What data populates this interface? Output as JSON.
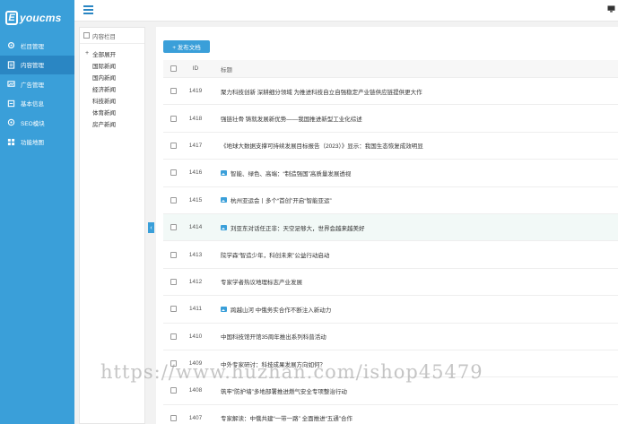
{
  "logo": {
    "letter": "E",
    "text": "youcms"
  },
  "sidebar": {
    "items": [
      {
        "label": "栏目管理",
        "icon": "gear-icon",
        "active": false
      },
      {
        "label": "内容管理",
        "icon": "document-icon",
        "active": true
      },
      {
        "label": "广告管理",
        "icon": "picture-icon",
        "active": false
      },
      {
        "label": "基本信息",
        "icon": "info-icon",
        "active": false
      },
      {
        "label": "SEO模块",
        "icon": "search-icon",
        "active": false
      },
      {
        "label": "功能地图",
        "icon": "map-icon",
        "active": false
      }
    ]
  },
  "tree": {
    "header": "内容栏目",
    "root": "全部展开",
    "items": [
      "国际新闻",
      "国内新闻",
      "经济新闻",
      "科技新闻",
      "体育新闻",
      "房产新闻"
    ]
  },
  "toolbar": {
    "publish_label": "+ 发布文档"
  },
  "table": {
    "columns": {
      "id": "ID",
      "title": "标题"
    },
    "rows": [
      {
        "id": "1419",
        "title": "聚力科技创新 深耕细分领域 为推进科技自立自强稳定产业链供应链提供更大作",
        "has_image": false
      },
      {
        "id": "1418",
        "title": "强链壮骨 铸就发展新优势——我国推进新型工业化综述",
        "has_image": false
      },
      {
        "id": "1417",
        "title": "《地球大数据支撑可持续发展目标报告（2023）》显示：我国生态恢复成效明显",
        "has_image": false
      },
      {
        "id": "1416",
        "title": "智能、绿色、高端：“制造强国”高质量发展透视",
        "has_image": true
      },
      {
        "id": "1415",
        "title": "杭州亚运会丨多个“首创”开启“智能亚运”",
        "has_image": true
      },
      {
        "id": "1414",
        "title": "刘亚东对话任正非：天空足够大，世界会越来越美好",
        "has_image": true
      },
      {
        "id": "1413",
        "title": "院学森“智造少年，科创未来”公益行动启动",
        "has_image": false
      },
      {
        "id": "1412",
        "title": "专家学者热议地理标志产业发展",
        "has_image": false
      },
      {
        "id": "1411",
        "title": "跨越山河 中俄务实合作不断注入新动力",
        "has_image": true
      },
      {
        "id": "1410",
        "title": "中国科技馆开馆35周年推出系列科普活动",
        "has_image": false
      },
      {
        "id": "1409",
        "title": "中外专家研讨：科技成果发展方向如何？",
        "has_image": false
      },
      {
        "id": "1408",
        "title": "筑牢“防护墙”多地部署推进燃气安全专项整治行动",
        "has_image": false
      },
      {
        "id": "1407",
        "title": "专家解读：中俄共建“一带一路” 全面推进“五通”合作",
        "has_image": false
      }
    ]
  },
  "watermark": "https://www.huzhan.com/ishop45479",
  "colors": {
    "sidebar": "#3a9fd9",
    "sidebar_active": "#2a86c3",
    "accent": "#3a9fd9"
  }
}
